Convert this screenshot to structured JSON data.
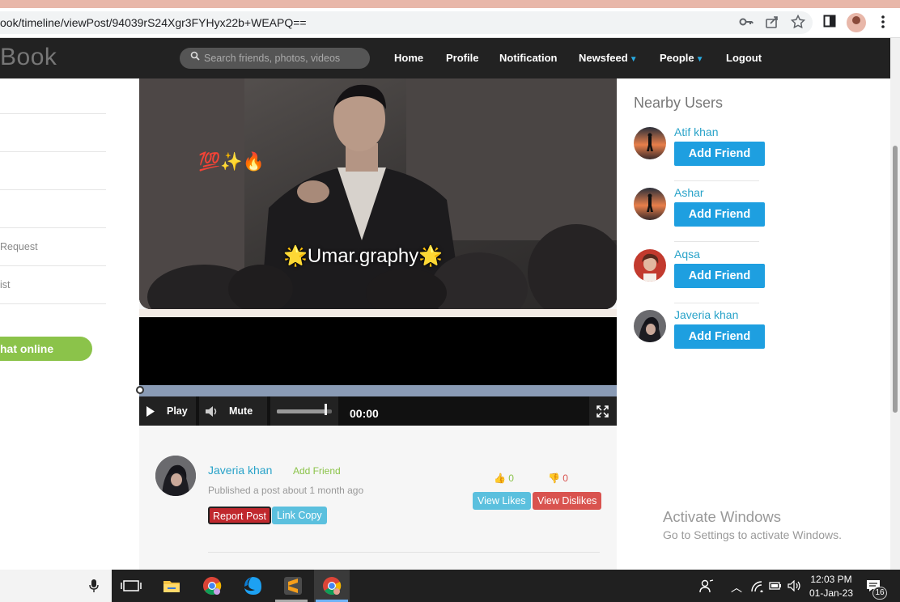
{
  "browser": {
    "url": "ook/timeline/viewPost/94039rS24Xgr3FYHyx22b+WEAPQ==",
    "icons": [
      "key-icon",
      "share-icon",
      "star-icon",
      "sidebar-icon",
      "profile-icon",
      "menu-dots-icon"
    ]
  },
  "nav": {
    "brand": "Book",
    "search_placeholder": "Search friends, photos, videos",
    "links": {
      "home": "Home",
      "profile": "Profile",
      "notification": "Notification",
      "newsfeed": "Newsfeed",
      "people": "People",
      "logout": "Logout"
    }
  },
  "left_sidebar": {
    "items": [
      "",
      "",
      "",
      "",
      "Request",
      "ist"
    ],
    "chat_online": "hat online"
  },
  "photo": {
    "emojis": "💯✨🔥",
    "caption": "🌟Umar.graphy🌟"
  },
  "video": {
    "play": "Play",
    "mute": "Mute",
    "time": "00:00",
    "volume": 0.9
  },
  "post": {
    "author": "Javeria khan",
    "add_friend": "Add Friend",
    "published": "Published a post about 1 month ago",
    "report": "Report Post",
    "link_copy": "Link Copy",
    "likes": "0",
    "dislikes": "0",
    "view_likes": "View Likes",
    "view_dislikes": "View Dislikes"
  },
  "nearby": {
    "title": "Nearby Users",
    "users": [
      {
        "name": "Atif khan",
        "button": "Add Friend"
      },
      {
        "name": "Ashar",
        "button": "Add Friend"
      },
      {
        "name": "Aqsa",
        "button": "Add Friend"
      },
      {
        "name": "Javeria khan",
        "button": "Add Friend"
      }
    ]
  },
  "watermark": {
    "line1": "Activate Windows",
    "line2": "Go to Settings to activate Windows."
  },
  "taskbar": {
    "time": "12:03 PM",
    "date": "01-Jan-23",
    "notifications": "16"
  },
  "colors": {
    "accent": "#29abe2",
    "button_blue": "#1e9fe0",
    "green": "#8bc34a",
    "red": "#d9534f",
    "nav_bg": "#222222"
  }
}
